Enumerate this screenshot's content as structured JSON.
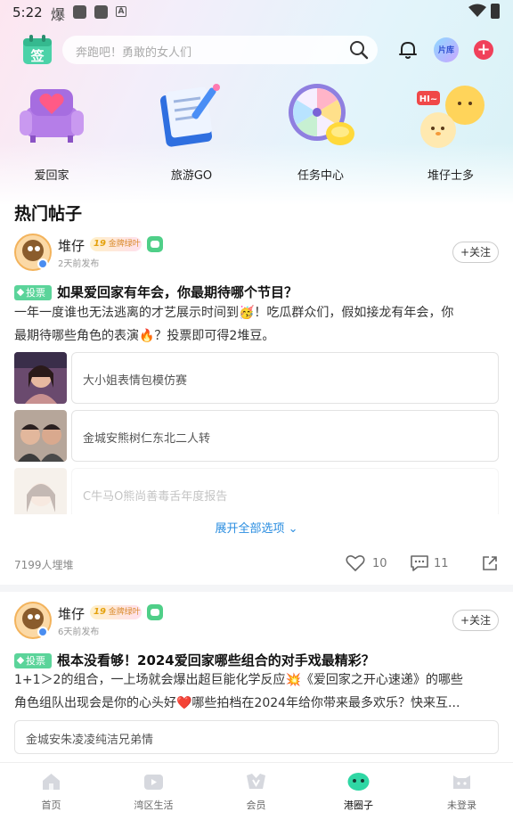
{
  "status_bar": {
    "time": "5:22",
    "glyph": "爆"
  },
  "header": {
    "sign_label": "签",
    "search_placeholder": "奔跑吧！勇敢的女人们",
    "library_label": "片库"
  },
  "quick_entries": [
    {
      "label": "爱回家",
      "icon": "sofa-heart-icon"
    },
    {
      "label": "旅游GO",
      "icon": "book-pencil-icon"
    },
    {
      "label": "任务中心",
      "icon": "wheel-icon"
    },
    {
      "label": "堆仔士多",
      "icon": "chicks-hi-icon"
    }
  ],
  "hot_posts_title": "热门帖子",
  "posts": [
    {
      "author": "堆仔",
      "level_num": "19",
      "level_text": "金牌绿叶",
      "time": "2天前发布",
      "follow": "+关注",
      "tag": "投票",
      "title": "如果爱回家有年会，你最期待哪个节目？",
      "body_line1": "一年一度谁也无法逃离的才艺展示时间到🥳！吃瓜群众们，假如接龙有年会，你",
      "body_line2": "最期待哪些角色的表演🔥？投票即可得2堆豆。",
      "options": [
        "大小姐表情包模仿赛",
        "金城安熊树仁东北二人转",
        "C牛马O熊尚善毒舌年度报告"
      ],
      "expand": "展开全部选项",
      "participants": "7199人埋堆",
      "likes": "10",
      "comments": "11"
    },
    {
      "author": "堆仔",
      "level_num": "19",
      "level_text": "金牌绿叶",
      "time": "6天前发布",
      "follow": "+关注",
      "tag": "投票",
      "title": "根本没看够！2024爱回家哪些组合的对手戏最精彩？",
      "body_line1": "1+1＞2的组合，一上场就会爆出超巨能化学反应💥《爱回家之开心速递》的哪些",
      "body_line2": "角色组队出现会是你的心头好❤️哪些拍档在2024年给你带来最多欢乐？快来互...",
      "options": [
        "金城安朱凌凌纯洁兄弟情"
      ]
    }
  ],
  "bottom_nav": [
    {
      "label": "首页",
      "icon": "home-icon",
      "active": false
    },
    {
      "label": "湾区生活",
      "icon": "video-icon",
      "active": false
    },
    {
      "label": "会员",
      "icon": "vip-icon",
      "active": false
    },
    {
      "label": "港圈子",
      "icon": "circle-icon",
      "active": true
    },
    {
      "label": "未登录",
      "icon": "profile-icon",
      "active": false
    }
  ],
  "colors": {
    "accent_green": "#5bd49a",
    "link_blue": "#2a8de0",
    "plus_red": "#f0405a"
  }
}
